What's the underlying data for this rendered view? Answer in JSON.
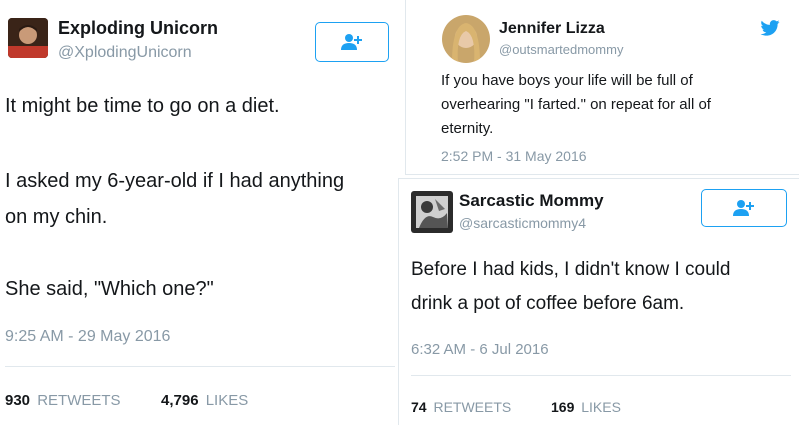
{
  "tweets": {
    "left": {
      "display_name": "Exploding Unicorn",
      "handle": "@XplodingUnicorn",
      "lines": [
        "It might be time to go on a diet.",
        "I asked my 6-year-old if I had anything",
        "on my chin.",
        "She said, \"Which one?\""
      ],
      "timestamp": "9:25 AM - 29 May 2016",
      "retweets_count": "930",
      "retweets_label": "RETWEETS",
      "likes_count": "4,796",
      "likes_label": "LIKES"
    },
    "top_right": {
      "display_name": "Jennifer Lizza",
      "handle": "@outsmartedmommy",
      "lines": [
        "If you have boys your life will be full of",
        "overhearing \"I farted.\" on repeat for all of",
        "eternity."
      ],
      "timestamp": "2:52 PM - 31 May 2016"
    },
    "bottom_right": {
      "display_name": "Sarcastic Mommy",
      "handle": "@sarcasticmommy4",
      "lines": [
        "Before I had kids, I didn't know I could",
        "drink a pot of coffee before 6am."
      ],
      "timestamp": "6:32 AM - 6 Jul 2016",
      "retweets_count": "74",
      "retweets_label": "RETWEETS",
      "likes_count": "169",
      "likes_label": "LIKES"
    }
  },
  "icons": {
    "follow": "add-user-icon",
    "brand": "twitter-bird-icon"
  },
  "colors": {
    "accent": "#1da1f2",
    "muted": "#8899a6",
    "text": "#14171a",
    "divider": "#e1e8ed"
  }
}
